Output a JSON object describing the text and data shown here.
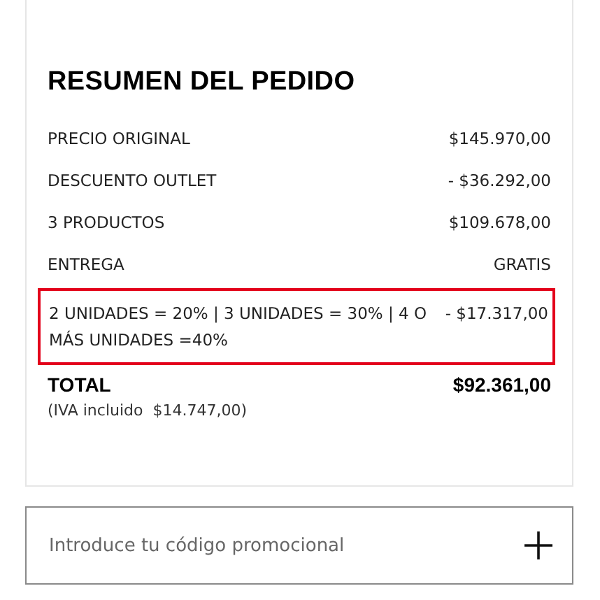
{
  "summary": {
    "title": "RESUMEN DEL PEDIDO",
    "rows": [
      {
        "label": "PRECIO ORIGINAL",
        "value": "$145.970,00"
      },
      {
        "label": "DESCUENTO OUTLET",
        "value": "- $36.292,00"
      },
      {
        "label": "3 PRODUCTOS",
        "value": "$109.678,00"
      },
      {
        "label": "ENTREGA",
        "value": "GRATIS"
      }
    ],
    "promotion": {
      "label": "2 UNIDADES = 20% | 3 UNIDADES = 30% | 4 O MÁS UNIDADES =40%",
      "value": "- $17.317,00"
    },
    "total": {
      "label": "TOTAL",
      "value": "$92.361,00",
      "tax_note": "(IVA incluido  $14.747,00)"
    }
  },
  "promo_code": {
    "placeholder": "Introduce tu código promocional"
  }
}
